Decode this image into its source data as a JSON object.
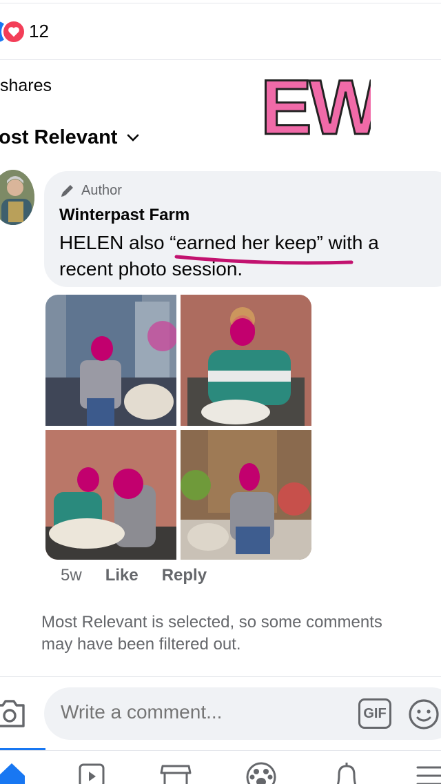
{
  "reactions": {
    "count": "12",
    "icons": [
      "like-icon",
      "love-icon"
    ],
    "colors": {
      "like": "#1877f2",
      "love": "#f33e58"
    }
  },
  "shares_label": "shares",
  "sort": {
    "label": "ost Relevant",
    "icon": "chevron-down-icon"
  },
  "sticker": {
    "text": "EW."
  },
  "comment": {
    "badge": "Author",
    "badge_icon": "pencil-icon",
    "author": "Winterpast Farm",
    "text": "HELEN also “earned her keep”  with a recent photo session.",
    "photos": [
      "photo-1",
      "photo-2",
      "photo-3",
      "photo-4"
    ],
    "time": "5w",
    "like_label": "Like",
    "reply_label": "Reply"
  },
  "filter_note": "Most Relevant is selected, so some comments may have been filtered out.",
  "composer": {
    "placeholder": "Write a comment...",
    "gif_label": "GIF",
    "icons": [
      "camera-icon",
      "gif-icon",
      "emoji-icon"
    ]
  },
  "bottom_nav": {
    "items": [
      "home-icon",
      "watch-icon",
      "marketplace-icon",
      "groups-icon",
      "notifications-icon",
      "menu-icon"
    ],
    "active_color": "#1877f2"
  }
}
